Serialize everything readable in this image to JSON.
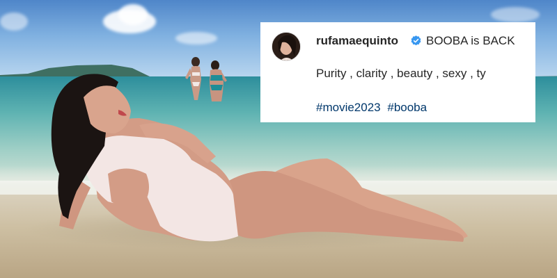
{
  "photo": {
    "subject": "woman-lying-on-beach",
    "background_people": 2,
    "colors": {
      "sky": "#5b8fcf",
      "sea": "#4ea7aa",
      "sand": "#cdbfa2",
      "swimsuit": "#f3e6e4"
    }
  },
  "post": {
    "username": "rufamaequinto",
    "verified": true,
    "verified_icon": "verified-badge-icon",
    "verified_color": "#3897f0",
    "title": "BOOBA is BACK",
    "body": "Purity , clarity , beauty , sexy , ty",
    "hashtags": [
      "#movie2023",
      "#booba"
    ],
    "hashtag_color": "#00376b"
  }
}
